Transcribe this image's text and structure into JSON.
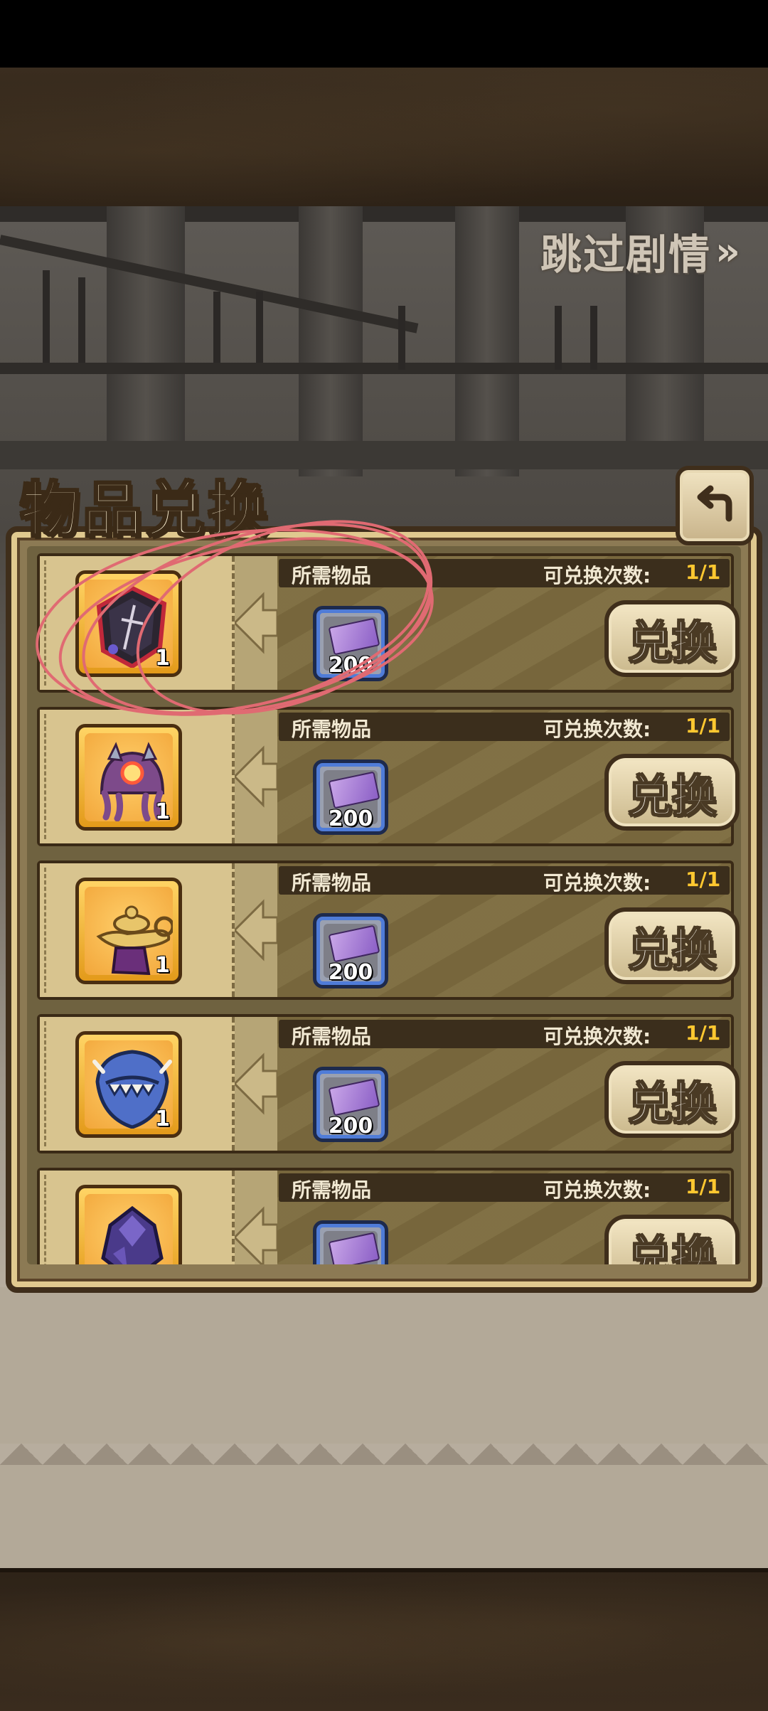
{
  "skip_story": {
    "label": "跳过剧情",
    "icon": "double-chevron-right-icon"
  },
  "panel": {
    "title": "物品兑换",
    "back_icon": "return-arrow-icon"
  },
  "column_labels": {
    "required_items": "所需物品",
    "exchange_limit": "可兑换次数:"
  },
  "rows": [
    {
      "reward": "dark-crest-shield-icon",
      "reward_count": "1",
      "cost_icon": "purple-ticket-icon",
      "cost_count": "200",
      "limit": "1/1",
      "button": "兑换"
    },
    {
      "reward": "purple-octopus-helm-icon",
      "reward_count": "1",
      "cost_icon": "purple-ticket-icon",
      "cost_count": "200",
      "limit": "1/1",
      "button": "兑换"
    },
    {
      "reward": "golden-magic-lamp-icon",
      "reward_count": "1",
      "cost_icon": "purple-ticket-icon",
      "cost_count": "200",
      "limit": "1/1",
      "button": "兑换"
    },
    {
      "reward": "blue-fanged-shell-icon",
      "reward_count": "1",
      "cost_icon": "purple-ticket-icon",
      "cost_count": "200",
      "limit": "1/1",
      "button": "兑换"
    },
    {
      "reward": "violet-crystal-icon",
      "reward_count": "",
      "cost_icon": "purple-ticket-icon",
      "cost_count": "",
      "limit": "1/1",
      "button": "兑换"
    }
  ],
  "colors": {
    "accent_gold": "#ffc830",
    "panel_brown": "#7d6c3f",
    "annotation_red": "#e06a72"
  }
}
